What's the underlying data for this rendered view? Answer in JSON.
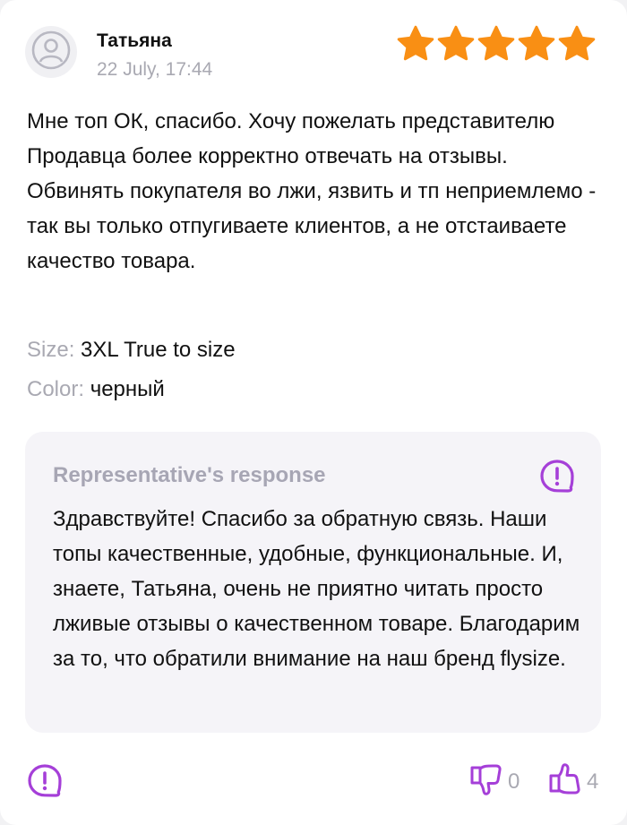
{
  "review": {
    "author": "Татьяна",
    "date": "22 July, 17:44",
    "rating": 5,
    "text": "Мне топ ОК, спасибо.  Хочу пожелать представителю Продавца более корректно отвечать на отзывы. Обвинять покупателя во лжи, язвить и тп неприемлемо - так вы только отпугиваете клиентов, а не отстаиваете качество товара.",
    "size_label": "Size:",
    "size_value": "3XL True to size",
    "color_label": "Color:",
    "color_value": "черный"
  },
  "response": {
    "title": "Representative's response",
    "text": "Здравствуйте! Спасибо за обратную связь. Наши топы качественные, удобные, функциональные. И, знаете, Татьяна, очень не приятно читать просто лживые отзывы о качественном товаре. Благодарим за то, что обратили внимание на наш бренд flysize."
  },
  "votes": {
    "dislikes": "0",
    "likes": "4"
  },
  "colors": {
    "accent": "#a53fd8",
    "star": "#f98f14",
    "muted": "#a9a9b2",
    "response_bg": "#f5f4f8"
  },
  "icons": [
    "user-avatar-icon",
    "star-icon",
    "report-icon",
    "thumbs-down-icon",
    "thumbs-up-icon"
  ]
}
